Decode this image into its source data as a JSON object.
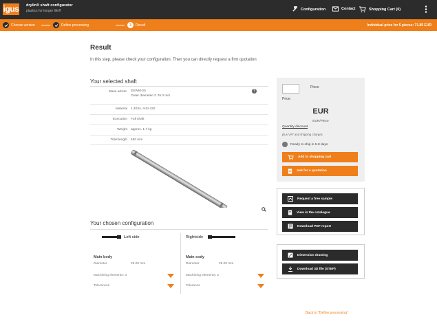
{
  "header": {
    "logo": "igus",
    "app_title": "drylin® shaft configurator",
    "app_subtitle": "plastics for longer life®",
    "nav": [
      {
        "label": "Configuration",
        "icon": "wrench-icon"
      },
      {
        "label": "Contact",
        "icon": "mail-icon"
      },
      {
        "label": "Shopping Cart (0)",
        "icon": "cart-icon"
      }
    ],
    "menu_icon": "kebab-menu-icon"
  },
  "steps": [
    {
      "label": "Choose version",
      "state": "done"
    },
    {
      "label": "Define processing",
      "state": "done"
    },
    {
      "label": "Result",
      "state": "active",
      "number": "3"
    }
  ],
  "price_note": "Individual price for 5 pieces: 71.85 EUR",
  "main": {
    "title": "Result",
    "intro": "In this step, please check your configuration. Then you can directly request a firm quotation",
    "shaft_heading": "Your selected shaft",
    "specs": [
      {
        "label": "Base article:",
        "value": "EEWM-25",
        "value2": "Outer diameter d: 25.0 mm"
      },
      {
        "label": "Material",
        "value": "1.4034, AISI 420"
      },
      {
        "label": "Execution",
        "value": "Full shaft"
      },
      {
        "label": "Weight",
        "value": "approx. 1.7 kg"
      },
      {
        "label": "Total length",
        "value": "450 mm"
      }
    ],
    "config_heading": "Your chosen configuration",
    "left": {
      "side_label": "Left side",
      "body_label": "Main body",
      "diameter_label": "Diameter",
      "diameter_value": "25.00 mm",
      "machining": "Machining elements: 3",
      "tolerances": "Tolerances"
    },
    "right": {
      "side_label": "Rightside",
      "body_label": "Main sody",
      "diameter_label": "Diameter",
      "diameter_value": "25.00 mm",
      "machining": "Machining elements: 2",
      "tolerances": "Toleraces"
    }
  },
  "order_panel": {
    "qty_value": "",
    "piece_label": "Piece",
    "price_label": "Price:",
    "currency": "EUR",
    "per_piece": "EUR/Piece",
    "quantity_discount": "Quantity discount",
    "vat_note": "plus VAT and shipping charges",
    "ship_note": "Ready to ship in 5-8 days",
    "add_to_cart": "Add to shopping cart",
    "ask_quotation": "Ask for a quotation"
  },
  "actions": {
    "free_sample": "Request a free sample",
    "catalogue": "View in the catalogue",
    "pdf": "Download PDF report",
    "dimension": "Dimension drawing",
    "step3d": "Download 3D file (STEP)"
  },
  "back_link": "Back to \"Define processing\"",
  "colors": {
    "accent": "#ef7f1a",
    "dark": "#2c2c2c",
    "panel": "#efefef"
  }
}
